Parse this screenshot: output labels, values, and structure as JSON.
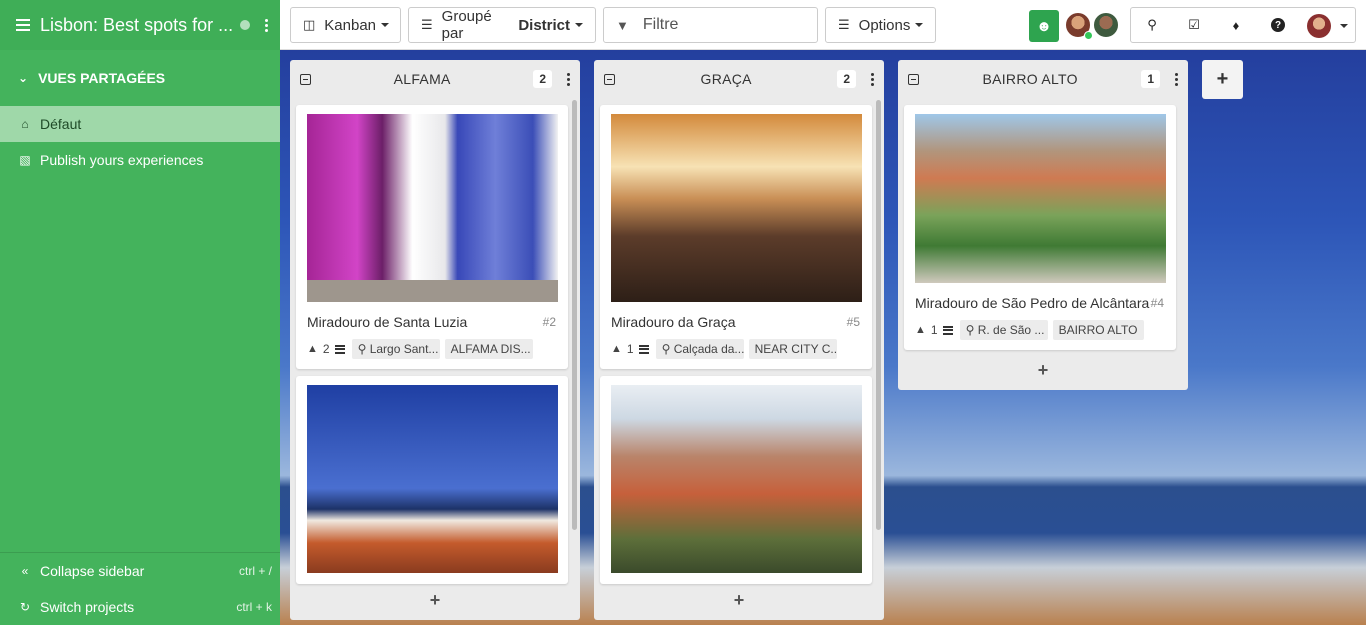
{
  "sidebar": {
    "project_title": "Lisbon: Best spots for ...",
    "section_label": "VUES PARTAGÉES",
    "views": [
      {
        "label": "Défaut",
        "icon": "home-icon",
        "active": true
      },
      {
        "label": "Publish yours experiences",
        "icon": "inbox-icon",
        "active": false
      }
    ],
    "footer": [
      {
        "label": "Collapse sidebar",
        "shortcut": "ctrl + /",
        "icon": "double-chevron-left-icon"
      },
      {
        "label": "Switch projects",
        "shortcut": "ctrl + k",
        "icon": "refresh-icon"
      }
    ],
    "colors": {
      "background": "#44b35c",
      "active_item": "#9fd8a9"
    }
  },
  "toolbar": {
    "view_label": "Kanban",
    "group_prefix": "Groupé par",
    "group_field": "District",
    "filter_placeholder": "Filtre",
    "options_label": "Options",
    "share_color": "#2ea44f"
  },
  "board": {
    "columns": [
      {
        "title": "ALFAMA",
        "count": "2",
        "cards": [
          {
            "title": "Miradouro de Santa Luzia",
            "number": "#2",
            "likes": "2",
            "address": "Largo Sant...",
            "tag": "ALFAMA DIS...",
            "image": "bougainvillea-azulejo-wall"
          },
          {
            "title": "",
            "number": "",
            "likes": "",
            "address": "",
            "tag": "",
            "image": "white-city-blue-sky"
          }
        ]
      },
      {
        "title": "GRAÇA",
        "count": "2",
        "cards": [
          {
            "title": "Miradouro da Graça",
            "number": "#5",
            "likes": "1",
            "address": "Calçada da...",
            "tag": "NEAR CITY C...",
            "image": "sunset-terrace-viewpoint"
          },
          {
            "title": "",
            "number": "",
            "likes": "",
            "address": "",
            "tag": "",
            "image": "couple-overlooking-rooftops"
          }
        ]
      },
      {
        "title": "BAIRRO ALTO",
        "count": "1",
        "cards": [
          {
            "title": "Miradouro de São Pedro de Alcântara",
            "number": "#4",
            "likes": "1",
            "address": "R. de São ...",
            "tag": "BAIRRO ALTO",
            "image": "garden-viewpoint-palm"
          }
        ]
      }
    ]
  }
}
